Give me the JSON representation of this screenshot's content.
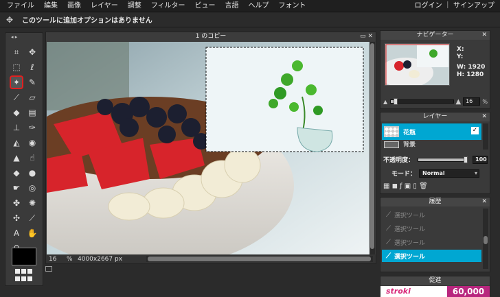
{
  "menu": {
    "items": [
      "ファイル",
      "編集",
      "画像",
      "レイヤー",
      "調整",
      "フィルター",
      "ビュー",
      "言語",
      "ヘルプ",
      "フォント"
    ],
    "account": "ログイン ｜ サインアップ"
  },
  "options": {
    "message": "このツールに追加オプションはありません"
  },
  "toolbox": {
    "arrows": "◂ ▸",
    "tools": [
      {
        "name": "crop-icon",
        "glyph": "⌗"
      },
      {
        "name": "move-icon",
        "glyph": "✥"
      },
      {
        "name": "marquee-icon",
        "glyph": "⬚"
      },
      {
        "name": "lasso-icon",
        "glyph": "ℓ"
      },
      {
        "name": "magic-wand-icon",
        "glyph": "✦"
      },
      {
        "name": "pencil-icon",
        "glyph": "✎"
      },
      {
        "name": "brush-icon",
        "glyph": "⟋"
      },
      {
        "name": "eraser-icon",
        "glyph": "▱"
      },
      {
        "name": "bucket-icon",
        "glyph": "◆"
      },
      {
        "name": "gradient-icon",
        "glyph": "▤"
      },
      {
        "name": "stamp-icon",
        "glyph": "⊥"
      },
      {
        "name": "color-replace-icon",
        "glyph": "✑"
      },
      {
        "name": "drawing-icon",
        "glyph": "◭"
      },
      {
        "name": "blur-icon",
        "glyph": "◉"
      },
      {
        "name": "sharpen-icon",
        "glyph": "▲"
      },
      {
        "name": "smudge-icon",
        "glyph": "☝"
      },
      {
        "name": "sponge-icon",
        "glyph": "◆"
      },
      {
        "name": "dodge-icon",
        "glyph": "●"
      },
      {
        "name": "burn-icon",
        "glyph": "☛"
      },
      {
        "name": "red-eye-icon",
        "glyph": "◎"
      },
      {
        "name": "spot-heal-icon",
        "glyph": "✤"
      },
      {
        "name": "bloat-icon",
        "glyph": "✺"
      },
      {
        "name": "pinch-icon",
        "glyph": "✣"
      },
      {
        "name": "color-picker-icon",
        "glyph": "⟋"
      },
      {
        "name": "type-icon",
        "glyph": "A"
      },
      {
        "name": "hand-icon",
        "glyph": "✋"
      },
      {
        "name": "zoom-icon",
        "glyph": "⚲"
      }
    ]
  },
  "document": {
    "title": "1 のコピー",
    "controls": "▭ ✕",
    "zoom": "16",
    "zoom_unit": "%",
    "size": "4000x2667 px"
  },
  "navigator": {
    "title": "ナビゲーター",
    "close": "✕",
    "x_label": "X:",
    "y_label": "Y:",
    "w_label": "W: 1920",
    "h_label": "H: 1280",
    "zoom_value": "16",
    "zoom_unit": "%"
  },
  "layers": {
    "title": "レイヤー",
    "close": "✕",
    "items": [
      {
        "name": "花瓶",
        "visible": "✓"
      },
      {
        "name": "背景"
      }
    ],
    "opacity_label": "不透明度：",
    "opacity_value": "100",
    "mode_label": "モード：",
    "mode_value": "Normal",
    "buttons": "▦  ◼  ƒ  ▣  ▯  🗑"
  },
  "history": {
    "title": "履歴",
    "close": "✕",
    "items": [
      "選択ツール",
      "選択ツール",
      "選択ツール",
      "選択ツール"
    ]
  },
  "promo": {
    "title": "促進",
    "brand": "stroki",
    "number": "60,000"
  }
}
